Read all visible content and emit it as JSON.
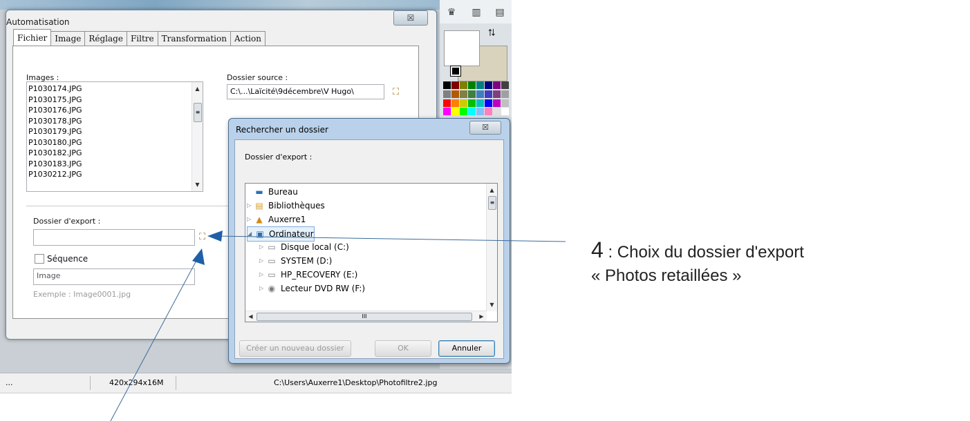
{
  "dialog": {
    "title": "Automatisation",
    "close_glyph": "☒",
    "tabs": [
      "Fichier",
      "Image",
      "Réglage",
      "Filtre",
      "Transformation",
      "Action"
    ],
    "images_label": "Images :",
    "images": [
      "P1030174.JPG",
      "P1030175.JPG",
      "P1030176.JPG",
      "P1030178.JPG",
      "P1030179.JPG",
      "P1030180.JPG",
      "P1030182.JPG",
      "P1030183.JPG",
      "P1030212.JPG"
    ],
    "source_label": "Dossier source :",
    "source_value": "C:\\...\\Laïcité\\9décembre\\V Hugo\\",
    "export_label": "Dossier d'export :",
    "export_value": "",
    "sequence_label": "Séquence",
    "sequence_value": "Image",
    "example_text": "Exemple : Image0001.jpg"
  },
  "browse": {
    "title": "Rechercher un dossier",
    "close_glyph": "☒",
    "label": "Dossier d'export :",
    "tree": [
      {
        "label": "Bureau",
        "icon": "desktop-icon",
        "glyph": "▬",
        "color": "#2b6fb5"
      },
      {
        "label": "Bibliothèques",
        "icon": "libraries-icon",
        "glyph": "▤",
        "color": "#d39b2a"
      },
      {
        "label": "Auxerre1",
        "icon": "user-folder-icon",
        "glyph": "▲",
        "color": "#d28b14"
      },
      {
        "label": "Ordinateur",
        "icon": "computer-icon",
        "glyph": "▣",
        "color": "#2c6cb0"
      },
      {
        "label": "Disque local (C:)",
        "icon": "local-disk-icon",
        "glyph": "▭",
        "color": "#6e7c8a"
      },
      {
        "label": "SYSTEM (D:)",
        "icon": "drive-icon",
        "glyph": "▭",
        "color": "#7a7a7a"
      },
      {
        "label": "HP_RECOVERY (E:)",
        "icon": "drive-icon",
        "glyph": "▭",
        "color": "#7a7a7a"
      },
      {
        "label": "Lecteur DVD RW (F:)",
        "icon": "dvd-drive-icon",
        "glyph": "◉",
        "color": "#7a7a7a"
      }
    ],
    "new_folder_button": "Créer un nouveau dossier",
    "ok_button": "OK",
    "cancel_button": "Annuler",
    "hscroll_thumb": "III"
  },
  "statusbar": {
    "left": "...",
    "size": "420x294x16M",
    "path": "C:\\Users\\Auxerre1\\Desktop\\Photofiltre2.jpg"
  },
  "annotation": {
    "number": "4",
    "line1_rest": " : Choix du dossier d'export",
    "line2": "« Photos retaillées »"
  }
}
